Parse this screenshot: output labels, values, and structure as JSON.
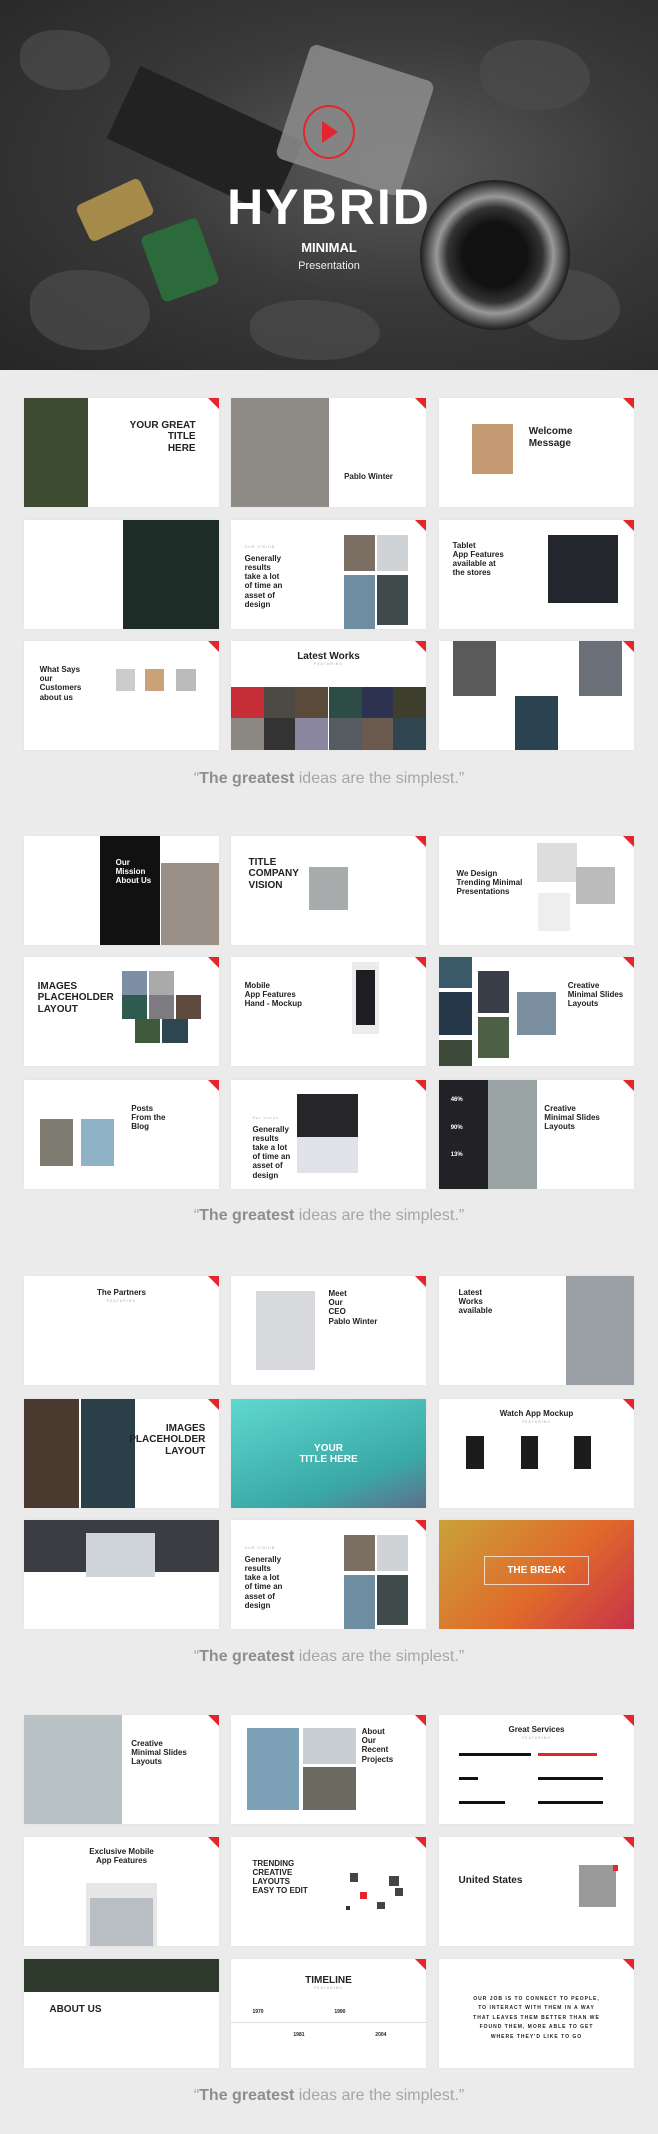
{
  "hero": {
    "logo": "play-circle-logo",
    "title": "HYBRID",
    "subtitle": "MINIMAL",
    "tagline": "Presentation",
    "accent": "#e4252d"
  },
  "quote": {
    "bold": "The greatest",
    "rest": " ideas are the simplest.",
    "open": "“",
    "close": "”"
  },
  "sections": [
    {
      "slides": [
        {
          "title": "YOUR GREAT\nTITLE\nHERE"
        },
        {
          "title": "Pablo Winter"
        },
        {
          "title": "Welcome\nMessage"
        },
        {
          "title": ""
        },
        {
          "title": "Generally\nresults\ntake a lot\nof time an\nasset of\ndesign",
          "sub": "OUR VISION"
        },
        {
          "title": "Tablet\nApp Features\navailable at\nthe stores"
        },
        {
          "title": "What Says\nour\nCustomers\nabout us"
        },
        {
          "title": "Latest Works",
          "sub": "FEATURING"
        },
        {
          "title": ""
        }
      ]
    },
    {
      "slides": [
        {
          "title": "Our\nMission\nAbout Us"
        },
        {
          "title": "TITLE\nCOMPANY\nVISION"
        },
        {
          "title": "We Design\nTrending Minimal\nPresentations"
        },
        {
          "title": "IMAGES\nPLACEHOLDER\nLAYOUT"
        },
        {
          "title": "Mobile\nApp Features\nHand - Mockup"
        },
        {
          "title": "Creative\nMinimal Slides\nLayouts"
        },
        {
          "title": "Posts\nFrom the\nBlog"
        },
        {
          "title": "Generally\nresults\ntake a lot\nof time an\nasset of\ndesign",
          "sub": "Our Vision"
        },
        {
          "title": "Creative\nMinimal Slides\nLayouts",
          "stats": [
            "46%",
            "90%",
            "13%"
          ]
        }
      ]
    },
    {
      "slides": [
        {
          "title": "The Partners",
          "sub": "FEATURING"
        },
        {
          "title": "Meet\nOur\nCEO\nPablo Winter"
        },
        {
          "title": "Latest\nWorks\navailable"
        },
        {
          "title": "IMAGES\nPLACEHOLDER\nLAYOUT"
        },
        {
          "title": "YOUR\nTITLE HERE"
        },
        {
          "title": "Watch App Mockup",
          "sub": "FEATURING"
        },
        {
          "title": ""
        },
        {
          "title": "Generally\nresults\ntake a lot\nof time an\nasset of\ndesign",
          "sub": "OUR VISION"
        },
        {
          "title": "THE BREAK"
        }
      ]
    },
    {
      "slides": [
        {
          "title": "Creative\nMinimal Slides\nLayouts"
        },
        {
          "title": "About\nOur\nRecent\nProjects"
        },
        {
          "title": "Great Services",
          "sub": "FEATURING"
        },
        {
          "title": "Exclusive Mobile\nApp Features"
        },
        {
          "title": "TRENDING\nCREATIVE\nLAYOUTS\nEASY TO EDIT"
        },
        {
          "title": "United States"
        },
        {
          "title": "ABOUT US"
        },
        {
          "title": "TIMELINE",
          "sub": "FEATURING",
          "years": [
            "1970",
            "1981",
            "1990",
            "2004"
          ]
        },
        {
          "title": "OUR JOB IS TO CONNECT TO PEOPLE,\nTO INTERACT WITH THEM IN A WAY\nTHAT LEAVES THEM BETTER THAN WE\nFOUND THEM, MORE ABLE TO GET\nWHERE THEY'D LIKE TO GO"
        }
      ]
    }
  ]
}
